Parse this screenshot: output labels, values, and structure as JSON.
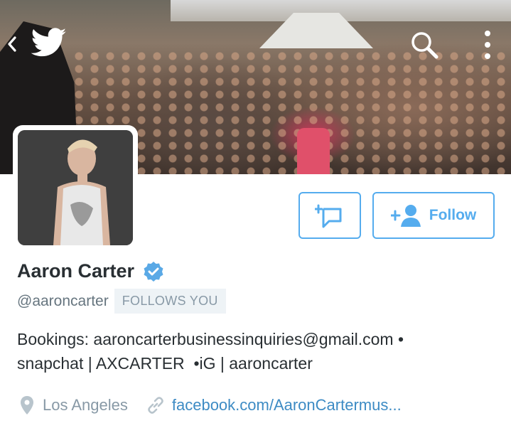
{
  "header": {
    "back_icon": "chevron-left-icon",
    "logo_icon": "twitter-bird-icon",
    "search_icon": "search-icon",
    "more_icon": "more-vertical-icon"
  },
  "actions": {
    "message_icon": "add-message-icon",
    "follow_icon": "add-user-icon",
    "follow_label": "Follow"
  },
  "profile": {
    "display_name": "Aaron Carter",
    "verified_icon": "verified-badge-icon",
    "handle": "@aaroncarter",
    "follows_you_label": "FOLLOWS YOU",
    "bio_lines": [
      "Bookings: aaroncarterbusinessinquiries@gmail.com •",
      "snapchat | AXCARTER  •iG | aaroncarter"
    ],
    "location": "Los Angeles",
    "url": "facebook.com/AaronCartermus..."
  },
  "colors": {
    "accent": "#55acee",
    "link": "#3d8bc4",
    "text_primary": "#292f33",
    "text_secondary": "#66757f",
    "muted": "#8899a6",
    "verified": "#5aa9e6"
  }
}
